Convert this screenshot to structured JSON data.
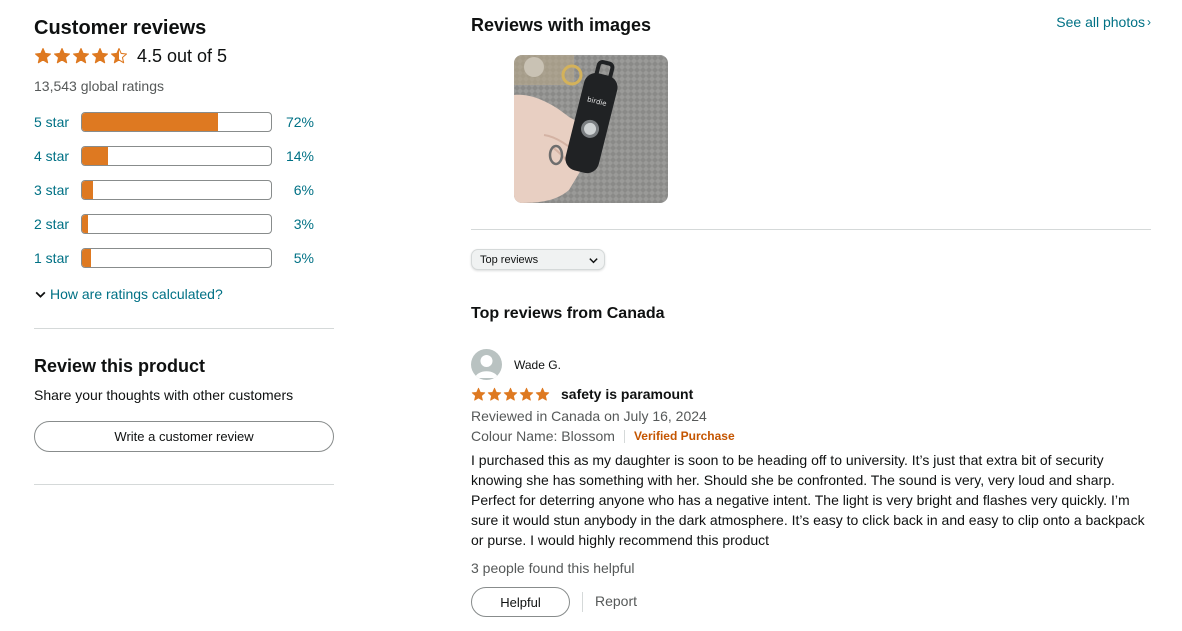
{
  "summary": {
    "title": "Customer reviews",
    "rating_value": 4.5,
    "rating_text": "4.5 out of 5",
    "global_ratings": "13,543 global ratings"
  },
  "histogram": [
    {
      "label": "5 star",
      "percent_text": "72%",
      "percent": 72
    },
    {
      "label": "4 star",
      "percent_text": "14%",
      "percent": 14
    },
    {
      "label": "3 star",
      "percent_text": "6%",
      "percent": 6
    },
    {
      "label": "2 star",
      "percent_text": "3%",
      "percent": 3
    },
    {
      "label": "1 star",
      "percent_text": "5%",
      "percent": 5
    }
  ],
  "how_calculated": "How are ratings calculated?",
  "review_product": {
    "title": "Review this product",
    "subtitle": "Share your thoughts with other customers",
    "button": "Write a customer review"
  },
  "images_section": {
    "title": "Reviews with images",
    "see_all": "See all photos",
    "photo_brand": "birdie"
  },
  "sort": {
    "selected": "Top reviews"
  },
  "region_heading": "Top reviews from Canada",
  "review": {
    "reviewer": "Wade G.",
    "stars": 5,
    "title": "safety is paramount",
    "reviewed_in": "Reviewed in Canada on July 16, 2024",
    "variant": "Colour Name: Blossom",
    "verified": "Verified Purchase",
    "body": "I purchased this as my daughter is soon to be heading off to university. It’s just that extra bit of security knowing she has something with her. Should she be confronted. The sound is very, very loud and sharp. Perfect for deterring anyone who has a negative intent. The light is very bright and flashes very quickly. I’m sure it would stun anybody in the dark atmosphere. It’s easy to click back in and easy to clip onto a backpack or purse. I would highly recommend this product",
    "helpful_count": "3 people found this helpful",
    "helpful_button": "Helpful",
    "report": "Report"
  },
  "colors": {
    "star": "#de7921",
    "link": "#007185",
    "verified": "#c45500",
    "muted": "#565959"
  }
}
